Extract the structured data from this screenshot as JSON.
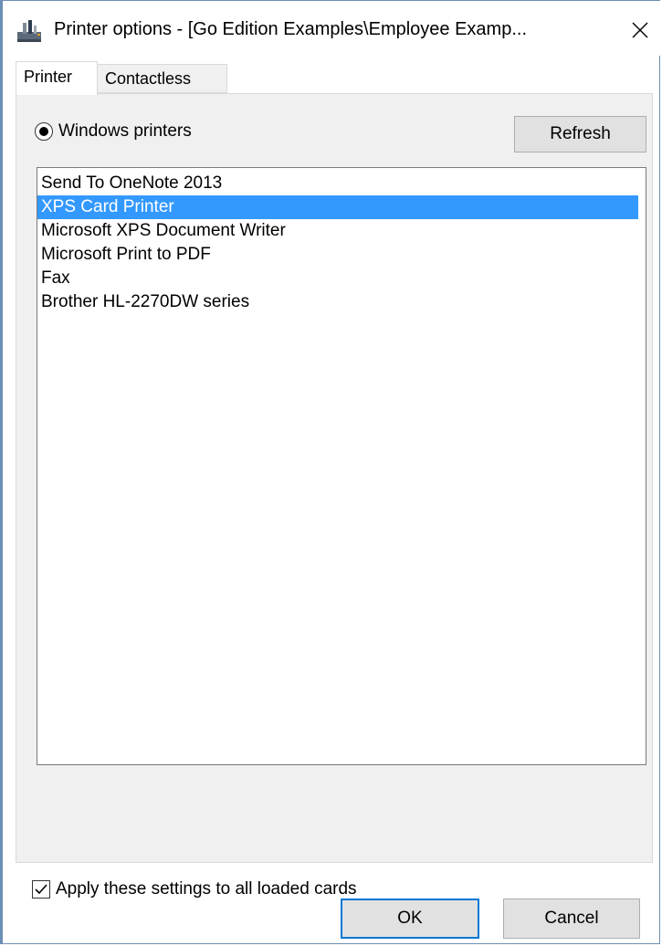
{
  "window": {
    "title": "Printer options - [Go Edition Examples\\Employee Examp...",
    "close_glyph": "✕"
  },
  "tabs": [
    {
      "label": "Printer",
      "active": true
    },
    {
      "label": "Contactless",
      "active": false
    }
  ],
  "printer_tab": {
    "source_radio_label": "Windows printers",
    "source_radio_checked": true,
    "refresh_label": "Refresh",
    "printers": [
      "Send To OneNote 2013",
      "XPS Card Printer",
      "Microsoft XPS Document Writer",
      "Microsoft Print to PDF",
      "Fax",
      "Brother HL-2270DW series"
    ],
    "selected_printer": "XPS Card Printer"
  },
  "footer": {
    "apply_all_label": "Apply these settings to all loaded cards",
    "apply_all_checked": true,
    "ok_label": "OK",
    "cancel_label": "Cancel"
  },
  "colors": {
    "selection": "#3399ff",
    "default_button_border": "#0078d7",
    "panel_background": "#f0f0f0"
  },
  "icons": {
    "title": "printer-icon",
    "close": "close-icon",
    "check": "checkmark-icon"
  }
}
